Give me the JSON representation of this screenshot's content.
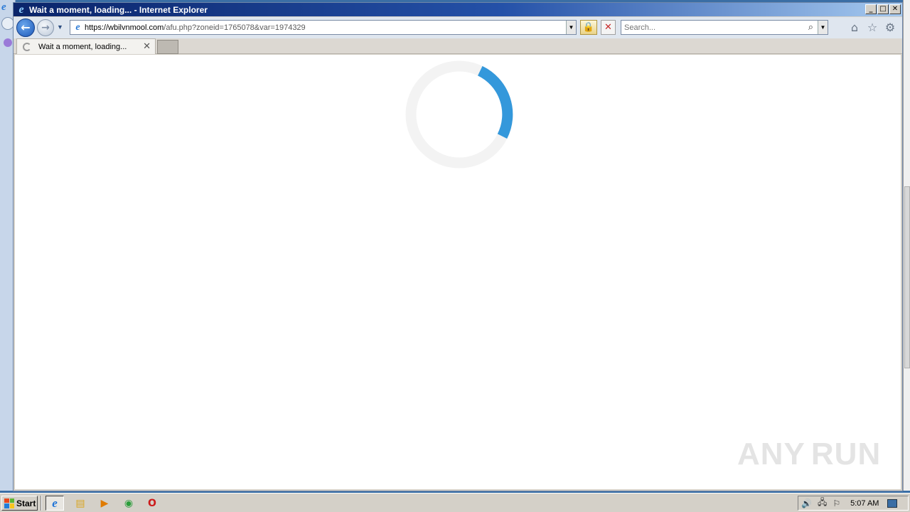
{
  "window": {
    "title": "Wait a moment, loading... - Internet Explorer",
    "minimize": "_",
    "maximize": "□",
    "close": "✕"
  },
  "nav": {
    "back": "←",
    "forward": "→",
    "history": "▼",
    "url_host": "https://wbilvnmool.com",
    "url_path": "/afu.php?zoneid=1765078&var=1974329",
    "address_dropdown": "▼",
    "lock": "🔒",
    "stop": "✕",
    "search_placeholder": "Search...",
    "search_icon": "⌕",
    "search_dropdown": "▼",
    "home": "⌂",
    "favorites": "☆",
    "tools": "⚙"
  },
  "tabs": [
    {
      "title": "Wait a moment, loading...",
      "close": "✕"
    }
  ],
  "page": {
    "spinner_color": "#3498db",
    "spinner_track_color": "#f3f3f3",
    "watermark_left": "ANY",
    "watermark_right": "RUN"
  },
  "taskbar": {
    "start_label": "Start",
    "apps": [
      {
        "name": "ie-icon",
        "glyph": "e",
        "color": "#1e73d6"
      },
      {
        "name": "folder-icon",
        "glyph": "▤",
        "color": "#d9a520"
      },
      {
        "name": "media-player-icon",
        "glyph": "▶",
        "color": "#e07b00"
      },
      {
        "name": "chrome-icon",
        "glyph": "◉",
        "color": "#2a9d3a"
      },
      {
        "name": "opera-icon",
        "glyph": "O",
        "color": "#cc1a1a"
      }
    ],
    "tray": {
      "volume": "🔊",
      "network": "🖧",
      "flag": "⚐",
      "clock": "5:07 AM"
    }
  }
}
